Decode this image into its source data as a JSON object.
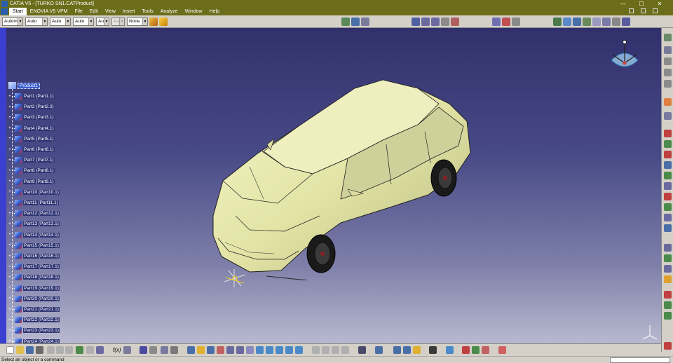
{
  "window": {
    "title": "CATIA V5 - [TURKO SN1.CATProduct]",
    "buttons": {
      "minimize": "—",
      "maximize": "☐",
      "close": "✕"
    }
  },
  "menu": {
    "items": [
      "Start",
      "ENOVIA V5 VPM",
      "File",
      "Edit",
      "View",
      "Insert",
      "Tools",
      "Analyze",
      "Window",
      "Help"
    ]
  },
  "toolbar": {
    "combos": [
      {
        "value": "Automa",
        "disabled": false
      },
      {
        "value": "Auto",
        "disabled": false
      },
      {
        "value": "Auto",
        "disabled": false
      },
      {
        "value": "Auto",
        "disabled": false
      },
      {
        "value": "Aut",
        "disabled": false
      },
      {
        "value": "Aut",
        "disabled": true
      },
      {
        "value": "None",
        "disabled": false
      }
    ]
  },
  "tree": {
    "root": "Product1",
    "parts": [
      "Part1 (Part1.1)",
      "Part2 (Part2.2)",
      "Part3 (Part3.1)",
      "Part4 (Part4.1)",
      "Part5 (Part5.1)",
      "Part6 (Part6.1)",
      "Part7 (Part7.1)",
      "Part8 (Part8.1)",
      "Part9 (Part9.1)",
      "Part10 (Part10.1)",
      "Part11 (Part11.1)",
      "Part12 (Part12.1)",
      "Part13 (Part13.1)",
      "Part14 (Part14.1)",
      "Part15 (Part15.1)",
      "Part16 (Part16.1)",
      "Part17 (Part17.1)",
      "Part18 (Part18.1)",
      "Part19 (Part19.1)",
      "Part20 (Part20.1)",
      "Part21 (Part21.1)",
      "Part22 (Part22.1)",
      "Part23 (Part23.1)",
      "Part24 (Part24.1)"
    ]
  },
  "bottom_toolbar": {
    "formula_label": "f(x)"
  },
  "status": {
    "message": "Select an object or a command"
  },
  "colors": {
    "titlebar": "#6c6d1a",
    "viewport_top": "#31306c",
    "viewport_bottom": "#b8b9cf",
    "selection": "#3a5ccc",
    "car_body": "#e3e4a6"
  }
}
